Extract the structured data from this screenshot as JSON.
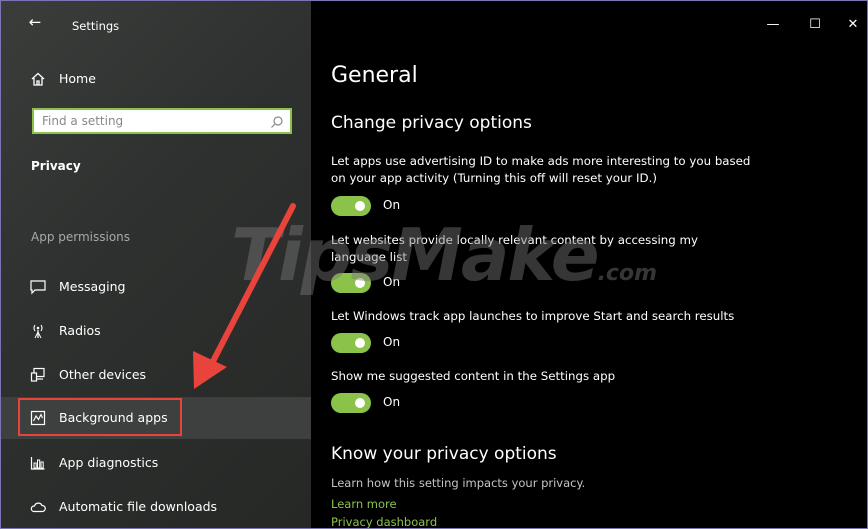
{
  "window": {
    "title": "Settings",
    "back_glyph": "←",
    "minimize_glyph": "—",
    "maximize_glyph": "☐",
    "close_glyph": "✕"
  },
  "sidebar": {
    "home_label": "Home",
    "search_placeholder": "Find a setting",
    "section_title": "Privacy",
    "group_label": "App permissions",
    "items": [
      {
        "label": "Messaging",
        "icon": "message-icon"
      },
      {
        "label": "Radios",
        "icon": "radio-antenna-icon"
      },
      {
        "label": "Other devices",
        "icon": "devices-icon"
      },
      {
        "label": "Background apps",
        "icon": "background-apps-icon"
      },
      {
        "label": "App diagnostics",
        "icon": "diagnostics-icon"
      },
      {
        "label": "Automatic file downloads",
        "icon": "cloud-icon"
      }
    ]
  },
  "main": {
    "page_title": "General",
    "sub_title": "Change privacy options",
    "options": [
      {
        "text": "Let apps use advertising ID to make ads more interesting to you based on your app activity (Turning this off will reset your ID.)",
        "state": "On"
      },
      {
        "text": "Let websites provide locally relevant content by accessing my language list",
        "state": "On"
      },
      {
        "text": "Let Windows track app launches to improve Start and search results",
        "state": "On"
      },
      {
        "text": "Show me suggested content in the Settings app",
        "state": "On"
      }
    ],
    "know_title": "Know your privacy options",
    "know_desc": "Learn how this setting impacts your privacy.",
    "links": [
      "Learn more",
      "Privacy dashboard"
    ]
  },
  "watermark": {
    "brand": "TipsMake",
    "suffix": ".com"
  },
  "colors": {
    "accent": "#8bc34a",
    "highlight_border": "#e8443c",
    "window_border": "#7a76b6"
  }
}
